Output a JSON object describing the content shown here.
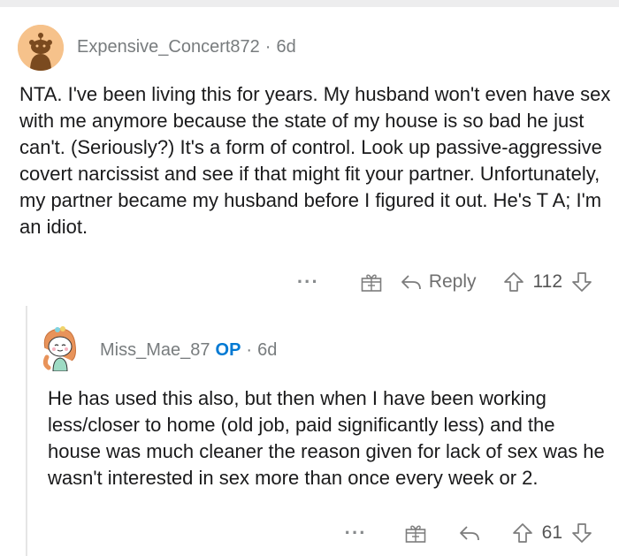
{
  "comment_1": {
    "username": "Expensive_Concert872",
    "separator": "·",
    "age": "6d",
    "body": "NTA. I've been living this for years. My husband won't even have sex with me anymore because the state of my house is so bad he just can't. (Seriously?) It's a form of control. Look up passive-aggressive covert narcissist and see if that might fit your partner. Unfortunately, my partner became my husband before I figured it out. He's T A; I'm an idiot.",
    "more_label": "···",
    "reply_label": "Reply",
    "votes": "112"
  },
  "comment_2": {
    "username": "Miss_Mae_87",
    "op_badge": "OP",
    "separator": "·",
    "age": "6d",
    "body": "He has used this also, but then when I have been working less/closer to home (old job, paid significantly less) and the house was much cleaner the reason given for lack of sex was he wasn't interested in sex more than once every week or 2.",
    "more_label": "···",
    "votes": "61"
  },
  "icons": {
    "avatar_1": "snoo-avatar",
    "avatar_2": "snoo-avatar-girl",
    "award": "gift-icon",
    "reply": "reply-arrow-icon",
    "upvote": "upvote-arrow-icon",
    "downvote": "downvote-arrow-icon"
  },
  "colors": {
    "op_badge": "#0079d3",
    "meta_text": "#787c7e",
    "body_text": "#1a1a1b",
    "avatar_1_bg": "#f6c28b"
  }
}
